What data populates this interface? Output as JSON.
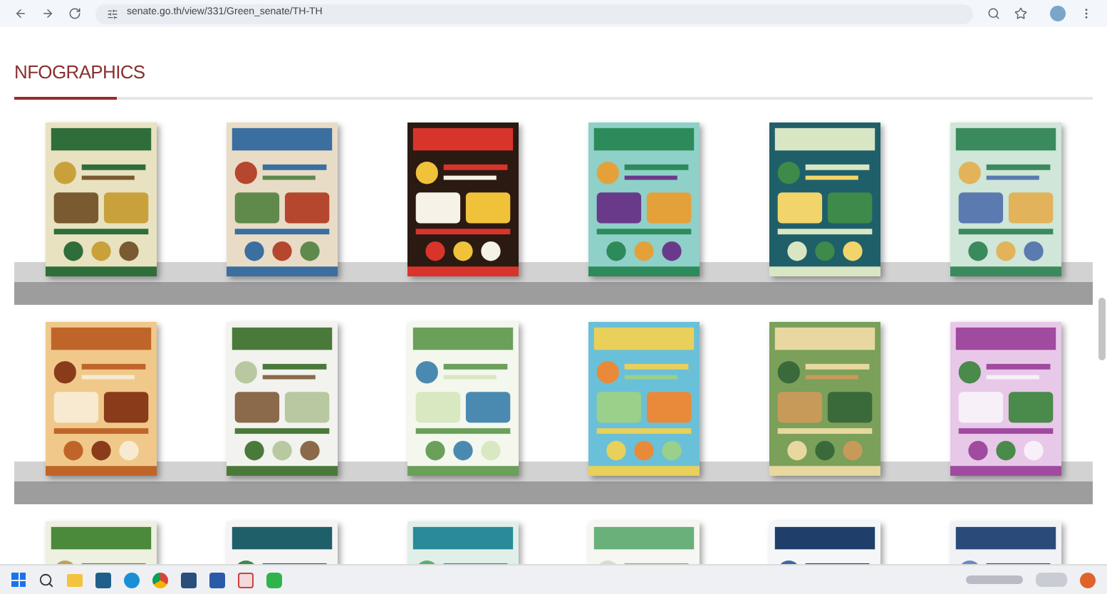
{
  "browser": {
    "url": "senate.go.th/view/331/Green_senate/TH-TH"
  },
  "page": {
    "heading": "NFOGRAPHICS"
  }
}
